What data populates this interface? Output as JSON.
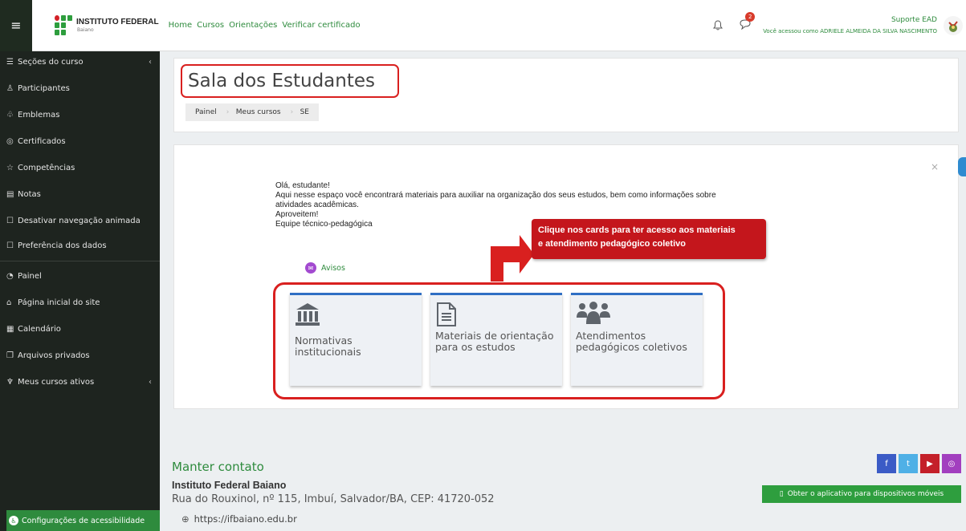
{
  "navbar": {
    "logo_main": "INSTITUTO FEDERAL",
    "logo_sub": "Baiano",
    "links": [
      "Home",
      "Cursos",
      "Orientações",
      "Verificar certificado"
    ],
    "notification_count": "2",
    "user_name": "Suporte EAD",
    "logged_in_as": "Você acessou como ADRIELE ALMEIDA DA SILVA NASCIMENTO"
  },
  "sidebar": {
    "items": [
      {
        "icon": "list-icon",
        "label": "Seções do curso",
        "chevron": "‹"
      },
      {
        "icon": "users-icon",
        "label": "Participantes"
      },
      {
        "icon": "badge-icon",
        "label": "Emblemas"
      },
      {
        "icon": "certificate-icon",
        "label": "Certificados"
      },
      {
        "icon": "star-icon",
        "label": "Competências"
      },
      {
        "icon": "grades-icon",
        "label": "Notas"
      },
      {
        "icon": "square-icon",
        "label": "Desativar navegação animada"
      },
      {
        "icon": "square-icon",
        "label": "Preferência dos dados"
      },
      {
        "icon": "gauge-icon",
        "label": "Painel"
      },
      {
        "icon": "home-icon",
        "label": "Página inicial do site"
      },
      {
        "icon": "calendar-icon",
        "label": "Calendário"
      },
      {
        "icon": "files-icon",
        "label": "Arquivos privados"
      },
      {
        "icon": "graduation-icon",
        "label": "Meus cursos ativos",
        "chevron": "‹"
      }
    ],
    "accessibility": "Configurações de acessibilidade"
  },
  "header": {
    "title": "Sala dos Estudantes",
    "breadcrumb": [
      "Painel",
      "Meus cursos",
      "SE"
    ]
  },
  "content": {
    "intro_lines": [
      "Olá, estudante!",
      "Aqui nesse espaço você encontrará materiais para auxiliar na organização dos seus estudos, bem como informações sobre",
      "atividades acadêmicas.",
      "Aproveitem!",
      "Equipe técnico-pedagógica"
    ],
    "avisos": "Avisos",
    "callout_line1": "Clique nos cards para ter acesso aos materiais",
    "callout_line2": "e atendimento pedagógico coletivo",
    "close": "×",
    "cards": [
      {
        "icon": "institution-icon",
        "label": "Normativas institucionais"
      },
      {
        "icon": "document-icon",
        "label": "Materiais de orientação para os estudos"
      },
      {
        "icon": "group-icon",
        "label": "Atendimentos pedagógicos coletivos"
      }
    ]
  },
  "footer": {
    "title": "Manter contato",
    "institution": "Instituto Federal Baiano",
    "address": "Rua do Rouxinol, nº 115, Imbuí, Salvador/BA, CEP: 41720-052",
    "site": "https://ifbaiano.edu.br",
    "app_button": "Obter o aplicativo para dispositivos móveis",
    "social_colors": {
      "facebook": "#3b5bc6",
      "twitter": "#4fb0e6",
      "youtube": "#c4202a",
      "instagram": "#a23fbf"
    }
  },
  "colors": {
    "accent_green": "#2e8b3d",
    "highlight_red": "#d9201f",
    "sidebar_bg": "#1e241f"
  }
}
